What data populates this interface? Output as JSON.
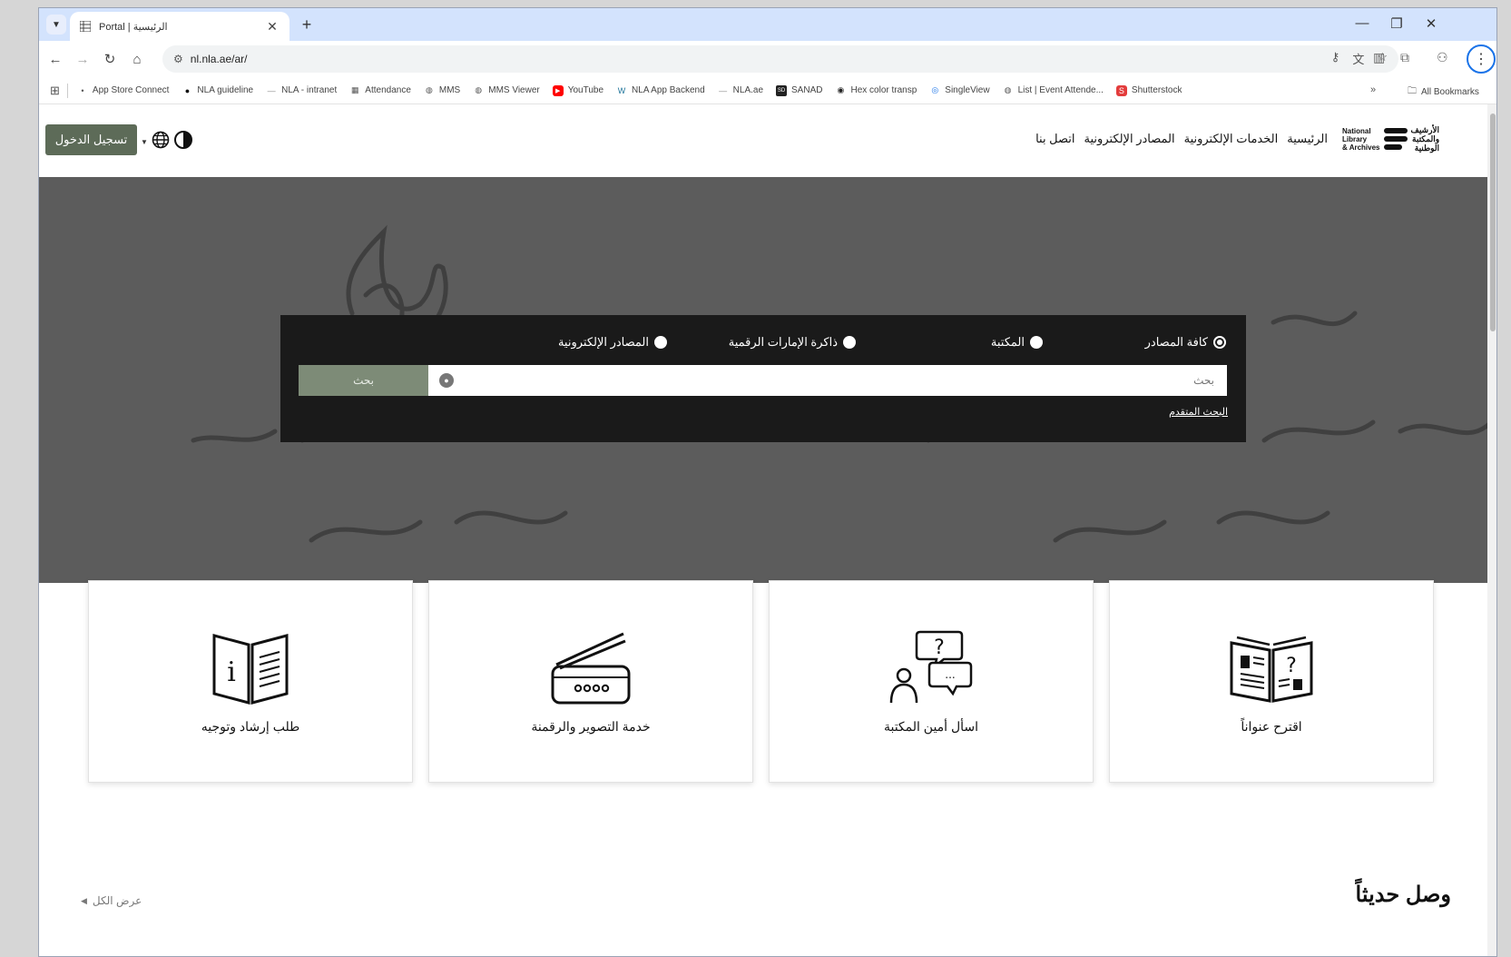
{
  "browser": {
    "tab_title": "Portal | الرئيسية",
    "url": "nl.nla.ae/ar/",
    "new_tab": "+",
    "tab_close": "✕",
    "window_controls": {
      "minimize": "—",
      "maximize": "❐",
      "close": "✕"
    },
    "bookmarks": [
      {
        "label": "App Store Connect",
        "icon": "apple-icon",
        "color": "#555555"
      },
      {
        "label": "NLA guideline",
        "icon": "circle-icon",
        "color": "#111111"
      },
      {
        "label": "NLA - intranet",
        "icon": "dash-icon",
        "color": "#888888"
      },
      {
        "label": "Attendance",
        "icon": "grid-icon",
        "color": "#555555"
      },
      {
        "label": "MMS",
        "icon": "globe-icon",
        "color": "#555555"
      },
      {
        "label": "MMS Viewer",
        "icon": "globe-icon",
        "color": "#555555"
      },
      {
        "label": "YouTube",
        "icon": "youtube-icon",
        "color": "#ff0000"
      },
      {
        "label": "NLA App Backend",
        "icon": "wordpress-icon",
        "color": "#21759b"
      },
      {
        "label": "NLA.ae",
        "icon": "dash-icon",
        "color": "#888888"
      },
      {
        "label": "SANAD",
        "icon": "sd-icon",
        "color": "#222222"
      },
      {
        "label": "Hex color transp",
        "icon": "github-icon",
        "color": "#222222"
      },
      {
        "label": "SingleView",
        "icon": "search-icon",
        "color": "#1a73e8"
      },
      {
        "label": "List | Event Attende...",
        "icon": "globe-icon",
        "color": "#555555"
      },
      {
        "label": "Shutterstock",
        "icon": "shutterstock-icon",
        "color": "#e33c3c"
      }
    ],
    "bookmarks_more": "»",
    "all_bookmarks": "All Bookmarks"
  },
  "header": {
    "logo_en": [
      "National",
      "Library",
      "& Archives"
    ],
    "logo_ar": [
      "الأرشيف",
      "والمكتبة",
      "الوطنية"
    ],
    "nav": [
      "الرئيسية",
      "الخدمات الإلكترونية",
      "المصادر الإلكترونية",
      "اتصل بنا"
    ],
    "login_label": "تسجيل الدخول"
  },
  "search": {
    "options": [
      {
        "label": "كافة المصادر",
        "selected": true
      },
      {
        "label": "المكتبة",
        "selected": false
      },
      {
        "label": "ذاكرة الإمارات الرقمية",
        "selected": false
      },
      {
        "label": "المصادر الإلكترونية",
        "selected": false
      }
    ],
    "placeholder": "بحث",
    "button_label": "بحث",
    "advanced_link": "البحث المتقدم"
  },
  "services": [
    {
      "label": "اقترح عنواناً",
      "icon": "book-question-icon"
    },
    {
      "label": "اسأل أمين المكتبة",
      "icon": "ask-librarian-icon"
    },
    {
      "label": "خدمة التصوير والرقمنة",
      "icon": "scanner-icon"
    },
    {
      "label": "طلب إرشاد وتوجيه",
      "icon": "info-book-icon"
    }
  ],
  "recent": {
    "title": "وصل حديثاً",
    "view_all": "عرض الكل"
  },
  "colors": {
    "login_button": "#5d6b58",
    "search_button": "#7d8b77",
    "search_panel": "#1a1a1a",
    "tab_strip": "#d3e3fd"
  }
}
